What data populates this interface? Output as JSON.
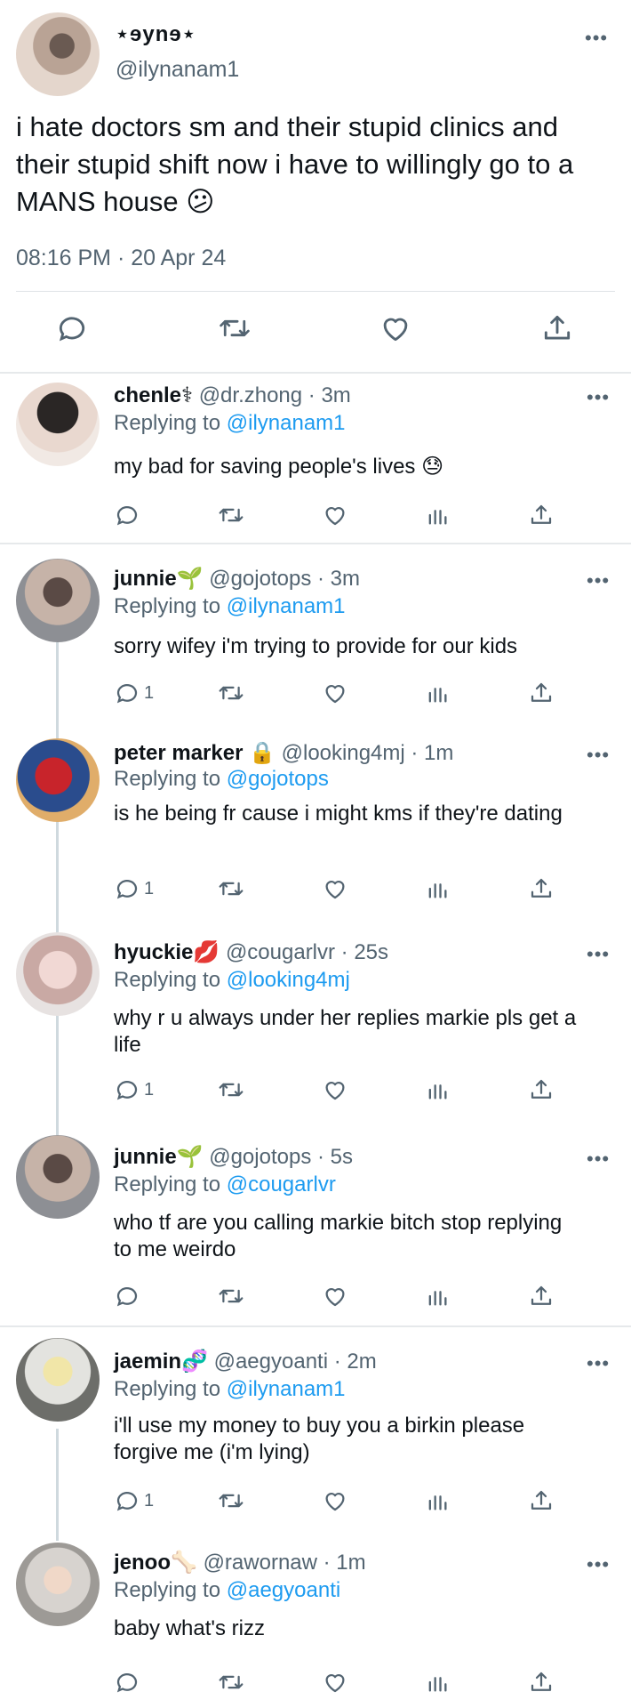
{
  "main_tweet": {
    "display_name": "⋆ɘynɘ⋆",
    "handle": "@ilynanam1",
    "text": "i hate doctors sm and their stupid clinics and their stupid shift now i have to willingly go to a MANS house 😕",
    "timestamp": "08:16 PM · 20 Apr 24",
    "more": "•••",
    "actions": [
      "reply-icon",
      "retweet-icon",
      "like-icon",
      "share-icon"
    ]
  },
  "replies": [
    {
      "name": "chenle⚕",
      "meta": "@dr.zhong · 3m",
      "replying_label": "Replying to",
      "replying_to": "@ilynanam1",
      "text": "my bad for saving people's lives 😓",
      "reply_count": ""
    },
    {
      "name": "junnie🌱",
      "meta": "@gojotops · 3m",
      "replying_label": "Replying to",
      "replying_to": "@ilynanam1",
      "text": "sorry wifey i'm trying to provide for our kids",
      "reply_count": "1"
    },
    {
      "name": "peter marker 🔒",
      "meta": "@looking4mj · 1m",
      "replying_label": "Replying to",
      "replying_to": "@gojotops",
      "text": "is he being fr cause i might kms if they're dating",
      "reply_count": "1"
    },
    {
      "name": "hyuckie💋",
      "meta": "@cougarlvr · 25s",
      "replying_label": "Replying to",
      "replying_to": "@looking4mj",
      "text": "why r u always under her replies markie pls get a life",
      "reply_count": "1"
    },
    {
      "name": "junnie🌱",
      "meta": "@gojotops · 5s",
      "replying_label": "Replying to",
      "replying_to": "@cougarlvr",
      "text": "who tf are you calling markie bitch stop replying to me weirdo",
      "reply_count": ""
    },
    {
      "name": "jaemin🧬",
      "meta": "@aegyoanti · 2m",
      "replying_label": "Replying to",
      "replying_to": "@ilynanam1",
      "text": "i'll use my money to buy you a birkin please forgive me (i'm lying)",
      "reply_count": "1"
    },
    {
      "name": "jenoo🦴",
      "meta": "@rawornaw · 1m",
      "replying_label": "Replying to",
      "replying_to": "@aegyoanti",
      "text": "baby what's rizz",
      "reply_count": ""
    }
  ],
  "colors": {
    "link": "#1d9bf0",
    "secondary_text": "#536471",
    "thread_line": "#cfd9de"
  }
}
